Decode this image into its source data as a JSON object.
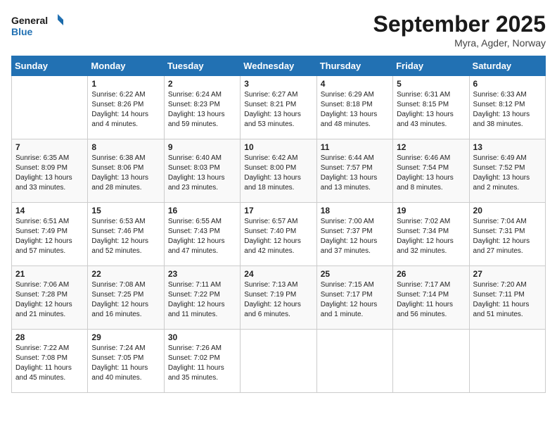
{
  "logo": {
    "line1": "General",
    "line2": "Blue"
  },
  "title": "September 2025",
  "location": "Myra, Agder, Norway",
  "days_header": [
    "Sunday",
    "Monday",
    "Tuesday",
    "Wednesday",
    "Thursday",
    "Friday",
    "Saturday"
  ],
  "weeks": [
    [
      {
        "num": "",
        "info": ""
      },
      {
        "num": "1",
        "info": "Sunrise: 6:22 AM\nSunset: 8:26 PM\nDaylight: 14 hours\nand 4 minutes."
      },
      {
        "num": "2",
        "info": "Sunrise: 6:24 AM\nSunset: 8:23 PM\nDaylight: 13 hours\nand 59 minutes."
      },
      {
        "num": "3",
        "info": "Sunrise: 6:27 AM\nSunset: 8:21 PM\nDaylight: 13 hours\nand 53 minutes."
      },
      {
        "num": "4",
        "info": "Sunrise: 6:29 AM\nSunset: 8:18 PM\nDaylight: 13 hours\nand 48 minutes."
      },
      {
        "num": "5",
        "info": "Sunrise: 6:31 AM\nSunset: 8:15 PM\nDaylight: 13 hours\nand 43 minutes."
      },
      {
        "num": "6",
        "info": "Sunrise: 6:33 AM\nSunset: 8:12 PM\nDaylight: 13 hours\nand 38 minutes."
      }
    ],
    [
      {
        "num": "7",
        "info": "Sunrise: 6:35 AM\nSunset: 8:09 PM\nDaylight: 13 hours\nand 33 minutes."
      },
      {
        "num": "8",
        "info": "Sunrise: 6:38 AM\nSunset: 8:06 PM\nDaylight: 13 hours\nand 28 minutes."
      },
      {
        "num": "9",
        "info": "Sunrise: 6:40 AM\nSunset: 8:03 PM\nDaylight: 13 hours\nand 23 minutes."
      },
      {
        "num": "10",
        "info": "Sunrise: 6:42 AM\nSunset: 8:00 PM\nDaylight: 13 hours\nand 18 minutes."
      },
      {
        "num": "11",
        "info": "Sunrise: 6:44 AM\nSunset: 7:57 PM\nDaylight: 13 hours\nand 13 minutes."
      },
      {
        "num": "12",
        "info": "Sunrise: 6:46 AM\nSunset: 7:54 PM\nDaylight: 13 hours\nand 8 minutes."
      },
      {
        "num": "13",
        "info": "Sunrise: 6:49 AM\nSunset: 7:52 PM\nDaylight: 13 hours\nand 2 minutes."
      }
    ],
    [
      {
        "num": "14",
        "info": "Sunrise: 6:51 AM\nSunset: 7:49 PM\nDaylight: 12 hours\nand 57 minutes."
      },
      {
        "num": "15",
        "info": "Sunrise: 6:53 AM\nSunset: 7:46 PM\nDaylight: 12 hours\nand 52 minutes."
      },
      {
        "num": "16",
        "info": "Sunrise: 6:55 AM\nSunset: 7:43 PM\nDaylight: 12 hours\nand 47 minutes."
      },
      {
        "num": "17",
        "info": "Sunrise: 6:57 AM\nSunset: 7:40 PM\nDaylight: 12 hours\nand 42 minutes."
      },
      {
        "num": "18",
        "info": "Sunrise: 7:00 AM\nSunset: 7:37 PM\nDaylight: 12 hours\nand 37 minutes."
      },
      {
        "num": "19",
        "info": "Sunrise: 7:02 AM\nSunset: 7:34 PM\nDaylight: 12 hours\nand 32 minutes."
      },
      {
        "num": "20",
        "info": "Sunrise: 7:04 AM\nSunset: 7:31 PM\nDaylight: 12 hours\nand 27 minutes."
      }
    ],
    [
      {
        "num": "21",
        "info": "Sunrise: 7:06 AM\nSunset: 7:28 PM\nDaylight: 12 hours\nand 21 minutes."
      },
      {
        "num": "22",
        "info": "Sunrise: 7:08 AM\nSunset: 7:25 PM\nDaylight: 12 hours\nand 16 minutes."
      },
      {
        "num": "23",
        "info": "Sunrise: 7:11 AM\nSunset: 7:22 PM\nDaylight: 12 hours\nand 11 minutes."
      },
      {
        "num": "24",
        "info": "Sunrise: 7:13 AM\nSunset: 7:19 PM\nDaylight: 12 hours\nand 6 minutes."
      },
      {
        "num": "25",
        "info": "Sunrise: 7:15 AM\nSunset: 7:17 PM\nDaylight: 12 hours\nand 1 minute."
      },
      {
        "num": "26",
        "info": "Sunrise: 7:17 AM\nSunset: 7:14 PM\nDaylight: 11 hours\nand 56 minutes."
      },
      {
        "num": "27",
        "info": "Sunrise: 7:20 AM\nSunset: 7:11 PM\nDaylight: 11 hours\nand 51 minutes."
      }
    ],
    [
      {
        "num": "28",
        "info": "Sunrise: 7:22 AM\nSunset: 7:08 PM\nDaylight: 11 hours\nand 45 minutes."
      },
      {
        "num": "29",
        "info": "Sunrise: 7:24 AM\nSunset: 7:05 PM\nDaylight: 11 hours\nand 40 minutes."
      },
      {
        "num": "30",
        "info": "Sunrise: 7:26 AM\nSunset: 7:02 PM\nDaylight: 11 hours\nand 35 minutes."
      },
      {
        "num": "",
        "info": ""
      },
      {
        "num": "",
        "info": ""
      },
      {
        "num": "",
        "info": ""
      },
      {
        "num": "",
        "info": ""
      }
    ]
  ]
}
